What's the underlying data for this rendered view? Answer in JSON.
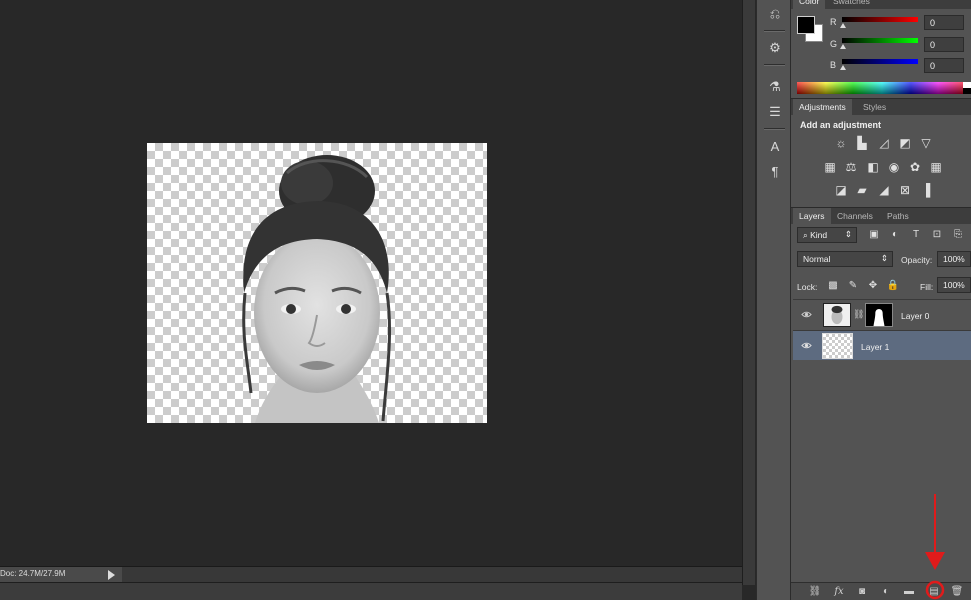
{
  "status": {
    "doc_info": "Doc: 24.7M/27.9M"
  },
  "color_panel": {
    "tabs": [
      "Color",
      "Swatches"
    ],
    "channels": [
      {
        "label": "R",
        "value": "0",
        "color": "#ff0000"
      },
      {
        "label": "G",
        "value": "0",
        "color": "#00ff00"
      },
      {
        "label": "B",
        "value": "0",
        "color": "#0000ff"
      }
    ],
    "foreground": "#000000",
    "background": "#ffffff"
  },
  "adjustments_panel": {
    "tabs": [
      "Adjustments",
      "Styles"
    ],
    "title": "Add an adjustment",
    "icons": [
      "brightness-contrast-icon",
      "levels-icon",
      "curves-icon",
      "exposure-icon",
      "vibrance-icon",
      "hue-saturation-icon",
      "color-balance-icon",
      "black-white-icon",
      "photo-filter-icon",
      "channel-mixer-icon",
      "color-lookup-icon",
      "invert-icon",
      "posterize-icon",
      "threshold-icon",
      "selective-color-icon",
      "gradient-map-icon"
    ]
  },
  "layers_panel": {
    "tabs": [
      "Layers",
      "Channels",
      "Paths"
    ],
    "filter_kind": "Kind",
    "blend_mode": "Normal",
    "opacity_label": "Opacity:",
    "opacity_value": "100%",
    "lock_label": "Lock:",
    "fill_label": "Fill:",
    "fill_value": "100%",
    "layers": [
      {
        "name": "Layer 0",
        "selected": false
      },
      {
        "name": "Layer 1",
        "selected": true
      }
    ],
    "selected_color": "#5d6b80",
    "highlight_color": "#e01b1b"
  }
}
